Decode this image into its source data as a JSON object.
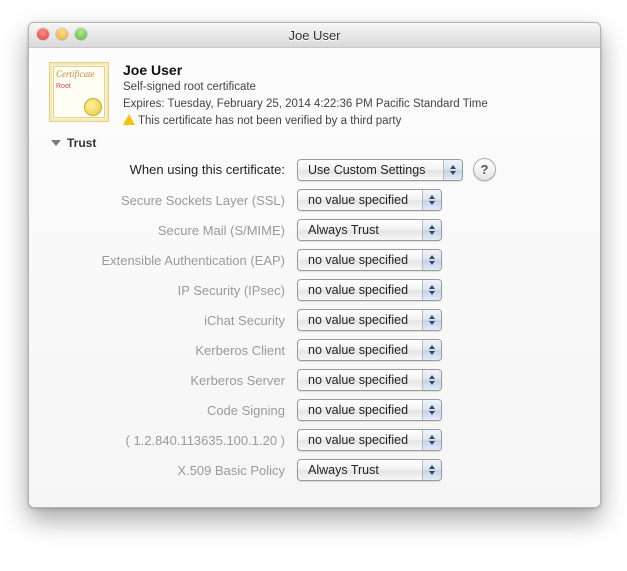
{
  "window": {
    "title": "Joe User"
  },
  "certificate": {
    "name": "Joe User",
    "type": "Self-signed root certificate",
    "expires": "Expires: Tuesday, February 25, 2014 4:22:36 PM Pacific Standard Time",
    "warning": "This certificate has not been verified by a third party"
  },
  "trust": {
    "section_label": "Trust",
    "when_using_label": "When using this certificate:",
    "when_using_value": "Use Custom Settings",
    "help_glyph": "?",
    "policies": [
      {
        "label": "Secure Sockets Layer (SSL)",
        "value": "no value specified"
      },
      {
        "label": "Secure Mail (S/MIME)",
        "value": "Always Trust"
      },
      {
        "label": "Extensible Authentication (EAP)",
        "value": "no value specified"
      },
      {
        "label": "IP Security (IPsec)",
        "value": "no value specified"
      },
      {
        "label": "iChat Security",
        "value": "no value specified"
      },
      {
        "label": "Kerberos Client",
        "value": "no value specified"
      },
      {
        "label": "Kerberos Server",
        "value": "no value specified"
      },
      {
        "label": "Code Signing",
        "value": "no value specified"
      },
      {
        "label": "( 1.2.840.113635.100.1.20 )",
        "value": "no value specified"
      },
      {
        "label": "X.509 Basic Policy",
        "value": "Always Trust"
      }
    ]
  }
}
